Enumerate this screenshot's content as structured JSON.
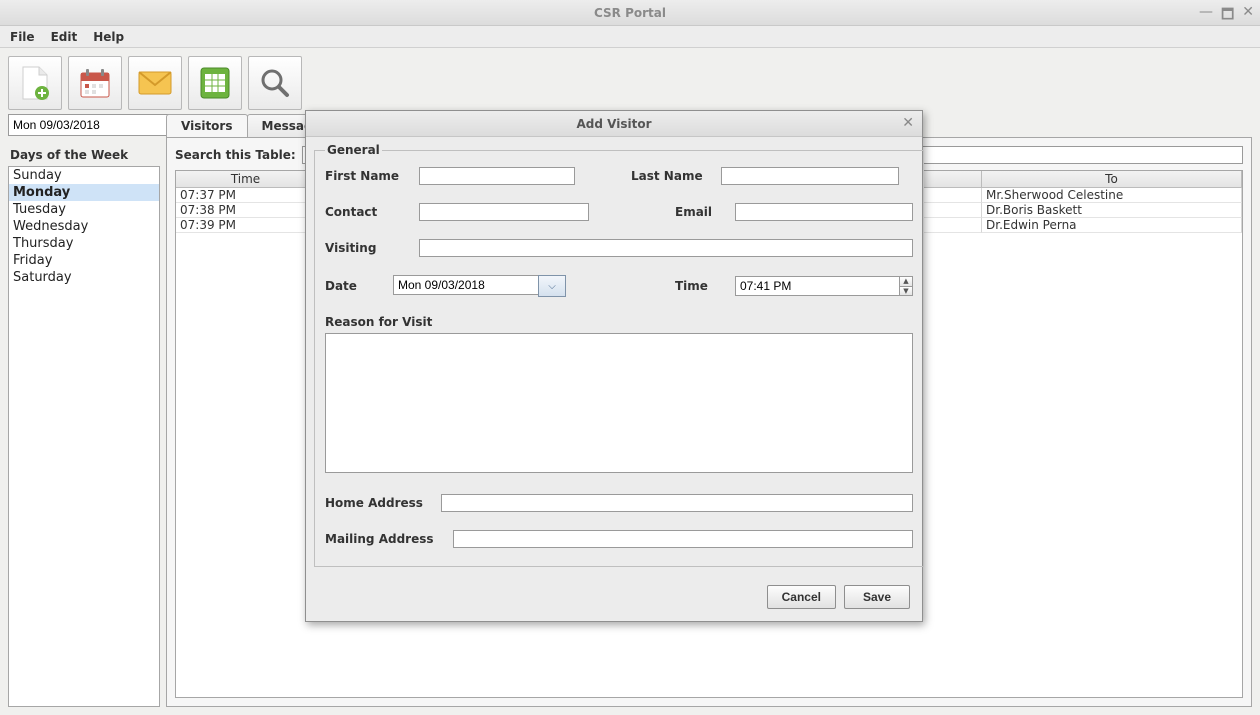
{
  "window": {
    "title": "CSR Portal",
    "minimize": "—",
    "maximize": "🗖",
    "close": "✕"
  },
  "menubar": {
    "file": "File",
    "edit": "Edit",
    "help": "Help"
  },
  "toolbar": {
    "icons": {
      "new": "new-document-icon",
      "calendar": "calendar-icon",
      "mail": "mail-icon",
      "excel": "spreadsheet-icon",
      "search": "search-icon"
    }
  },
  "left": {
    "date_value": "Mon 09/03/2018",
    "days_title": "Days of the Week",
    "days": [
      "Sunday",
      "Monday",
      "Tuesday",
      "Wednesday",
      "Thursday",
      "Friday",
      "Saturday"
    ],
    "selected_index": 1
  },
  "tabs": {
    "visitors": "Visitors",
    "messages": "Messages"
  },
  "visitors_panel": {
    "search_label": "Search this Table:",
    "columns": {
      "time": "Time",
      "to": "To"
    },
    "rows": [
      {
        "time": "07:37 PM",
        "to": "Mr.Sherwood Celestine"
      },
      {
        "time": "07:38 PM",
        "to": "Dr.Boris Baskett"
      },
      {
        "time": "07:39 PM",
        "to": "Dr.Edwin Perna"
      }
    ]
  },
  "dialog": {
    "title": "Add Visitor",
    "section": "General",
    "labels": {
      "first_name": "First Name",
      "last_name": "Last Name",
      "contact": "Contact",
      "email": "Email",
      "visiting": "Visiting",
      "date": "Date",
      "time": "Time",
      "reason": "Reason for Visit",
      "home_address": "Home Address",
      "mailing_address": "Mailing Address"
    },
    "date_value": "Mon 09/03/2018",
    "time_value": "07:41 PM",
    "buttons": {
      "cancel": "Cancel",
      "save": "Save"
    }
  }
}
